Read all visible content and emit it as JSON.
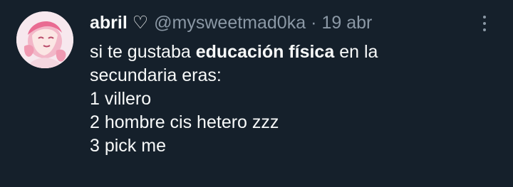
{
  "tweet": {
    "author": {
      "name": "abril ♡",
      "handle": "@mysweetmad0ka",
      "separator": "·",
      "date": "19 abr"
    },
    "text": {
      "line1_before": "si te gustaba ",
      "line1_bold": "educación física",
      "line1_after": " en la",
      "line2": "secundaria eras:",
      "line3": "1 villero",
      "line4": "2 hombre cis hetero zzz",
      "line5": "3 pick me"
    },
    "avatar": {
      "description_icon": "avatar-icon"
    },
    "actions": {
      "more_icon": "more-options-icon"
    }
  },
  "colors": {
    "background": "#15202b",
    "text": "#f7f9f9",
    "muted": "#8b98a5"
  }
}
